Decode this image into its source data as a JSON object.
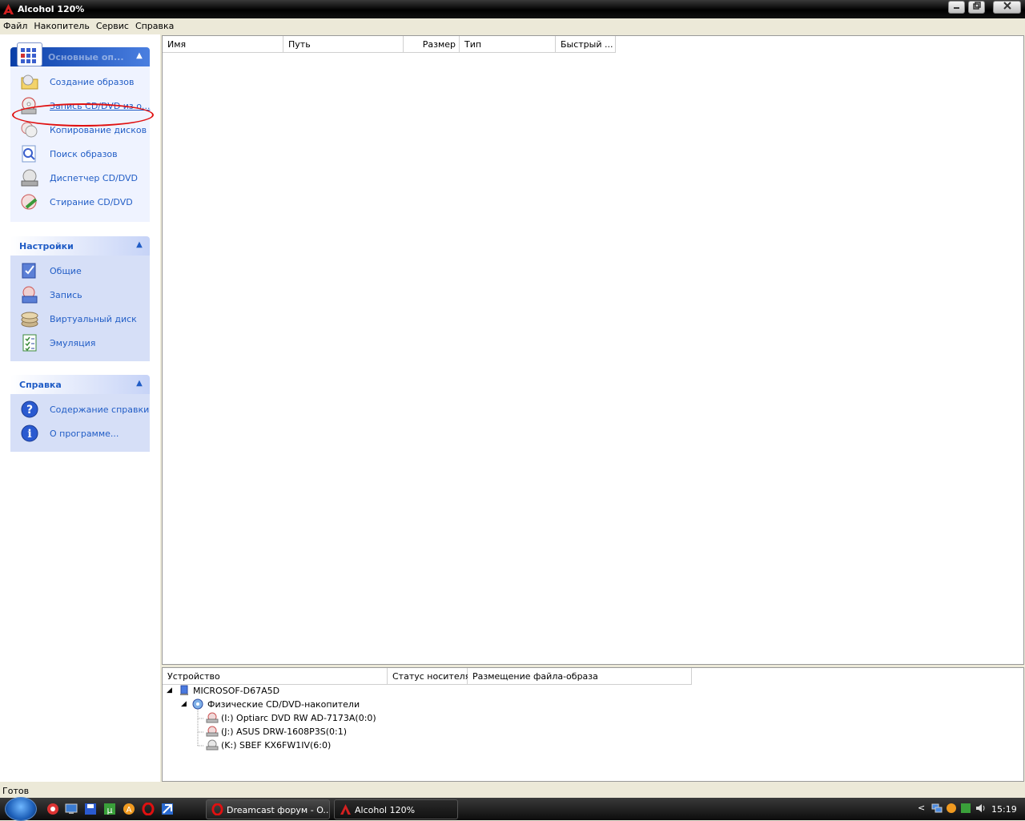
{
  "window": {
    "title": "Alcohol 120%",
    "min": "0",
    "max": "1",
    "close": "r"
  },
  "menu": [
    "Файл",
    "Накопитель",
    "Сервис",
    "Справка"
  ],
  "groups": {
    "main": {
      "title": "Основные оп...",
      "items": [
        "Создание образов",
        "Запись CD/DVD из о...",
        "Копирование дисков",
        "Поиск образов",
        "Диспетчер CD/DVD",
        "Стирание CD/DVD"
      ]
    },
    "settings": {
      "title": "Настройки",
      "items": [
        "Общие",
        "Запись",
        "Виртуальный диск",
        "Эмуляция"
      ]
    },
    "help": {
      "title": "Справка",
      "items": [
        "Содержание справки",
        "О программе..."
      ]
    }
  },
  "filelist": {
    "columns": [
      "Имя",
      "Путь",
      "Размер",
      "Тип",
      "Быстрый ..."
    ]
  },
  "devices": {
    "columns": [
      "Устройство",
      "Статус носителя",
      "Размещение файла-образа"
    ],
    "computer": "MICROSOF-D67A5D",
    "category": "Физические CD/DVD-накопители",
    "drives": [
      "(I:) Optiarc DVD RW AD-7173A(0:0)",
      "(J:) ASUS DRW-1608P3S(0:1)",
      "(K:) SBEF KX6FW1IV(6:0)"
    ]
  },
  "status": "Готов",
  "taskbar": {
    "buttons": [
      "Dreamcast форум - O...",
      "Alcohol 120%"
    ],
    "clock": "15:19"
  },
  "colors": {
    "accent": "#215dc6",
    "panel": "#d6dff7",
    "highlight": "#e01010"
  }
}
